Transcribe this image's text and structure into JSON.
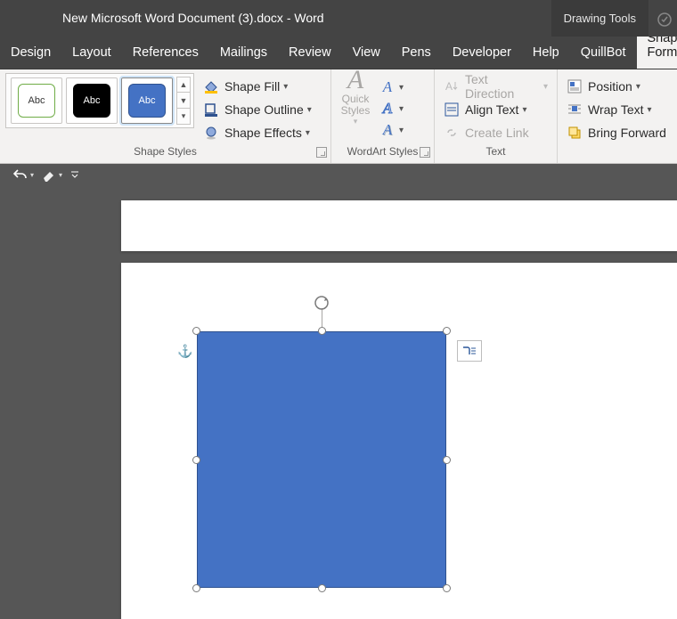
{
  "title": "New Microsoft Word Document (3).docx  -  Word",
  "drawing_tools": "Drawing Tools",
  "tabs": {
    "design": "Design",
    "layout": "Layout",
    "references": "References",
    "mailings": "Mailings",
    "review": "Review",
    "view": "View",
    "pens": "Pens",
    "developer": "Developer",
    "help": "Help",
    "quillbot": "QuillBot",
    "shape_format": "Shape Format"
  },
  "groups": {
    "shape_styles": "Shape Styles",
    "wordart_styles": "WordArt Styles",
    "text": "Text",
    "arrange": ""
  },
  "gallery": {
    "abc": "Abc"
  },
  "cmds": {
    "shape_fill": "Shape Fill",
    "shape_outline": "Shape Outline",
    "shape_effects": "Shape Effects",
    "quick_styles": "Quick Styles",
    "text_direction": "Text Direction",
    "align_text": "Align Text",
    "create_link": "Create Link",
    "position": "Position",
    "wrap_text": "Wrap Text",
    "bring_forward": "Bring Forward"
  },
  "shape_color": "#4472C4",
  "shape_border": "#2F528F"
}
